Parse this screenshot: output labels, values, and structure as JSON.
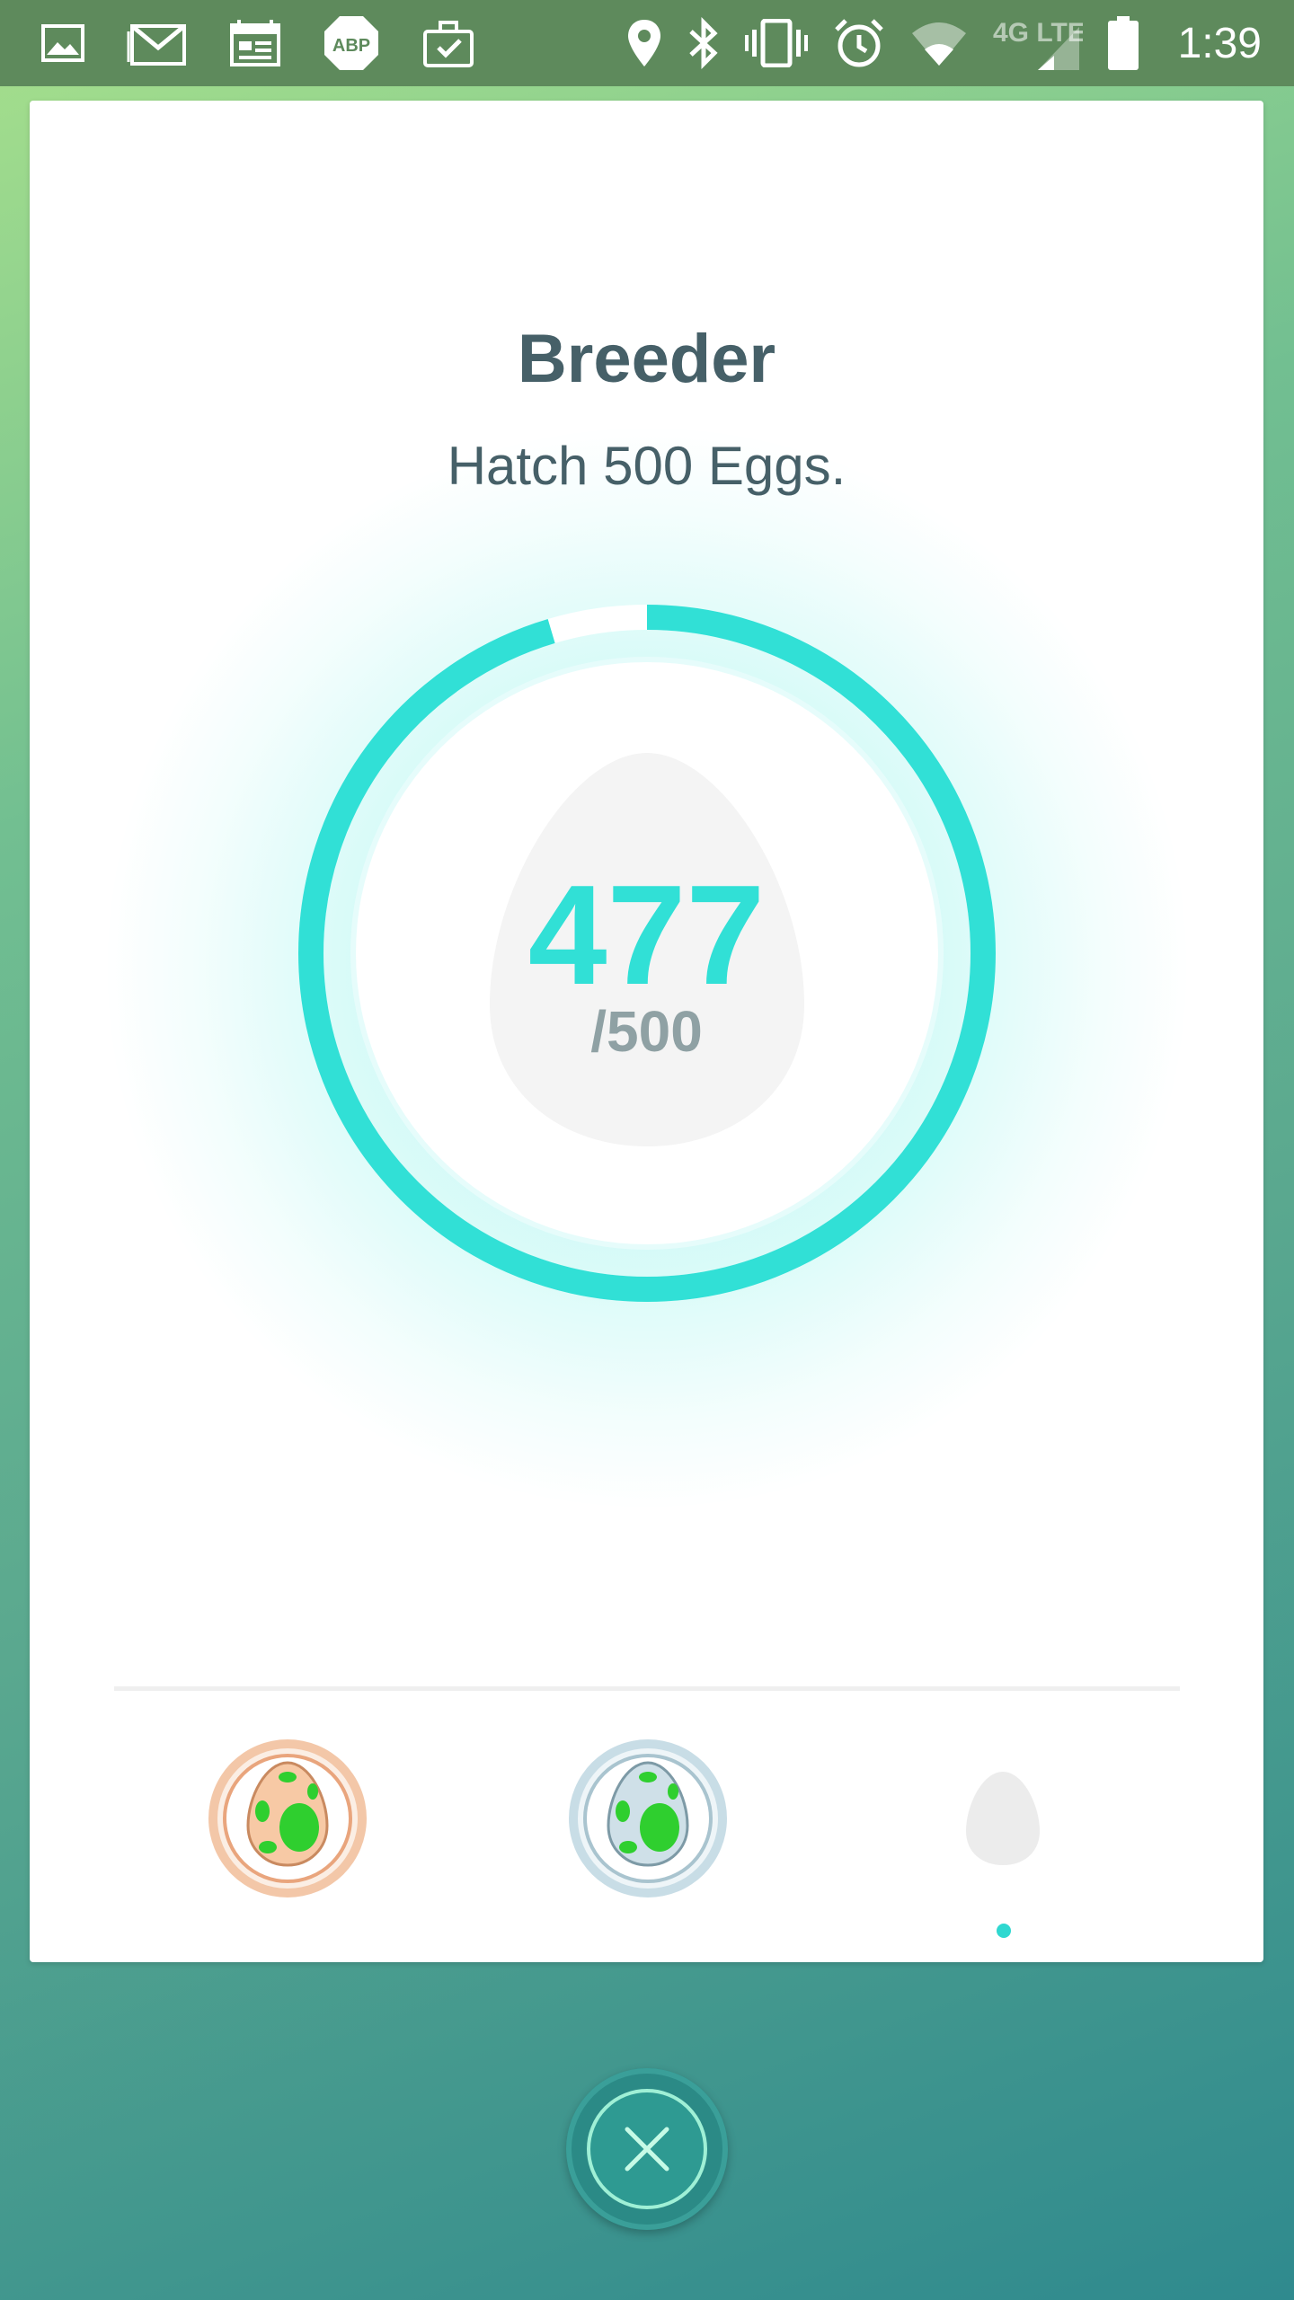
{
  "status_bar": {
    "time": "1:39",
    "network_label": "4G LTE",
    "left_icons": [
      "gallery-icon",
      "gmail-icon",
      "calendar-icon",
      "adblock-icon",
      "briefcase-check-icon"
    ],
    "right_icons": [
      "location-icon",
      "bluetooth-icon",
      "vibrate-icon",
      "alarm-icon",
      "wifi-icon",
      "signal-icon",
      "battery-icon"
    ],
    "adblock_label": "ABP"
  },
  "medal": {
    "title": "Breeder",
    "description": "Hatch 500 Eggs.",
    "count": "477",
    "total": "/500",
    "progress_fraction": 0.954
  },
  "tiers": [
    {
      "name": "bronze",
      "unlocked": true
    },
    {
      "name": "silver",
      "unlocked": true
    },
    {
      "name": "gold",
      "unlocked": false
    }
  ],
  "colors": {
    "accent": "#31e0d6",
    "text": "#466068",
    "muted": "#8fa1a4",
    "status_bar": "#5e8a5c"
  }
}
